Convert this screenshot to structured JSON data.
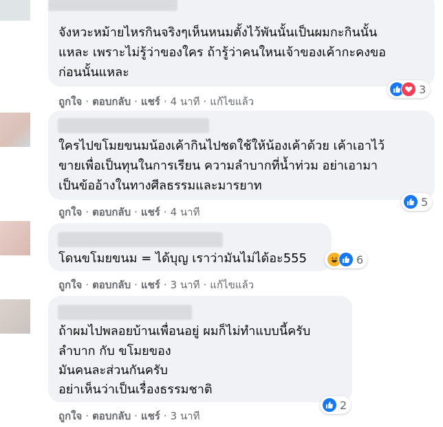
{
  "comments": [
    {
      "lines": [
        "จังหวะหม้ายไหรกินจริงๆเห็นหนมตั้งไว้พันนั้นเป็นผมกะกินนั้น",
        "แหละ เพราะไม่รู้ว่าของใคร ถ้ารู้ว่าคนใหนเจ้าของเค้ากะคงขอ",
        "ก่อนนั้นแหละ"
      ],
      "actions": {
        "like": "ถูกใจ",
        "reply": "ตอบกลับ",
        "share": "แชร์",
        "time": "4 นาที",
        "edited": "แก้ไขแล้ว"
      },
      "reactions": {
        "icons": [
          "like-icon",
          "love-icon"
        ],
        "count": "3"
      }
    },
    {
      "lines": [
        "ใครไปขโมยขนมน้องเค้ากินไปชดใช้ให้น้องเค้าด้วย เค้าเอาไว้",
        "ขายเพื่อเป็นทุนในการเรียน ความลำบากที่น้ำท่วม อย่าเอามา",
        "เป็นข้ออ้างในทางศีลธรรมและมารยาท"
      ],
      "actions": {
        "like": "ถูกใจ",
        "reply": "ตอบกลับ",
        "share": "แชร์",
        "time": "4 นาที"
      },
      "reactions": {
        "icons": [
          "like-icon"
        ],
        "count": "5"
      }
    },
    {
      "lines": [
        "โดนขโมยขนม = ได้บุญ เราว่ามันไม่ได้อะ555"
      ],
      "actions": {
        "like": "ถูกใจ",
        "reply": "ตอบกลับ",
        "share": "แชร์",
        "time": "3 นาที",
        "edited": "แก้ไขแล้ว"
      },
      "reactions": {
        "icons": [
          "haha-icon",
          "like-icon"
        ],
        "count": "6"
      }
    },
    {
      "lines": [
        "ถ้าผมไปพลอยบ้านเพื่อนอยู่ ผมก็ไม่ทำแบบนี้ครับ",
        "ลำบาก กับ ขโมยของ",
        "มันคนละส่วนกันครับ",
        "อย่าเห็นว่าเป็นเรื่องธรรมชาติ"
      ],
      "actions": {
        "like": "ถูกใจ",
        "reply": "ตอบกลับ",
        "share": "แชร์",
        "time": "3 นาที"
      },
      "reactions": {
        "icons": [
          "like-icon"
        ],
        "count": "2"
      }
    }
  ],
  "colors": {
    "bubble": "#f0f2f5",
    "action_text": "#65676b",
    "like": "#1877f2",
    "love": "#f33e58",
    "haha": "#f7b125"
  }
}
